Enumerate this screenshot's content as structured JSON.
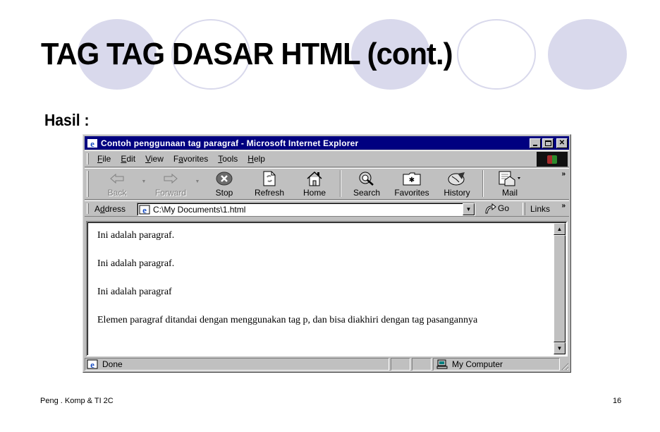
{
  "slide": {
    "title": "TAG TAG DASAR HTML (cont.)",
    "subtitle": "Hasil :",
    "footer_left": "Peng . Komp & TI 2C",
    "page_number": "16",
    "decor_color": "#d9d9ec"
  },
  "browser": {
    "window_title": "Contoh penggunaan tag paragraf - Microsoft Internet Explorer",
    "title_bar_color": "#000080",
    "window_buttons": {
      "minimize": "_",
      "maximize": "□",
      "close": "✕"
    },
    "menu": [
      {
        "label": "File",
        "accel": "F",
        "rest": "ile"
      },
      {
        "label": "Edit",
        "accel": "E",
        "rest": "dit"
      },
      {
        "label": "View",
        "accel": "V",
        "rest": "iew"
      },
      {
        "label": "Favorites",
        "pre": "F",
        "accel": "a",
        "rest": "vorites"
      },
      {
        "label": "Tools",
        "accel": "T",
        "rest": "ools"
      },
      {
        "label": "Help",
        "accel": "H",
        "rest": "elp"
      }
    ],
    "toolbar": {
      "back": "Back",
      "forward": "Forward",
      "stop": "Stop",
      "refresh": "Refresh",
      "home": "Home",
      "search": "Search",
      "favorites": "Favorites",
      "history": "History",
      "mail": "Mail",
      "more": "»"
    },
    "address": {
      "label_pre": "A",
      "label_accel": "d",
      "label_rest": "dress",
      "value": "C:\\My Documents\\1.html",
      "go": "Go",
      "links": "Links",
      "more": "»"
    },
    "page": {
      "paragraphs": [
        "Ini adalah paragraf.",
        "Ini adalah paragraf.",
        "Ini adalah paragraf",
        "Elemen paragraf ditandai dengan menggunakan tag p, dan bisa diakhiri dengan tag pasangannya"
      ]
    },
    "status": {
      "text": "Done",
      "zone": "My Computer"
    }
  }
}
